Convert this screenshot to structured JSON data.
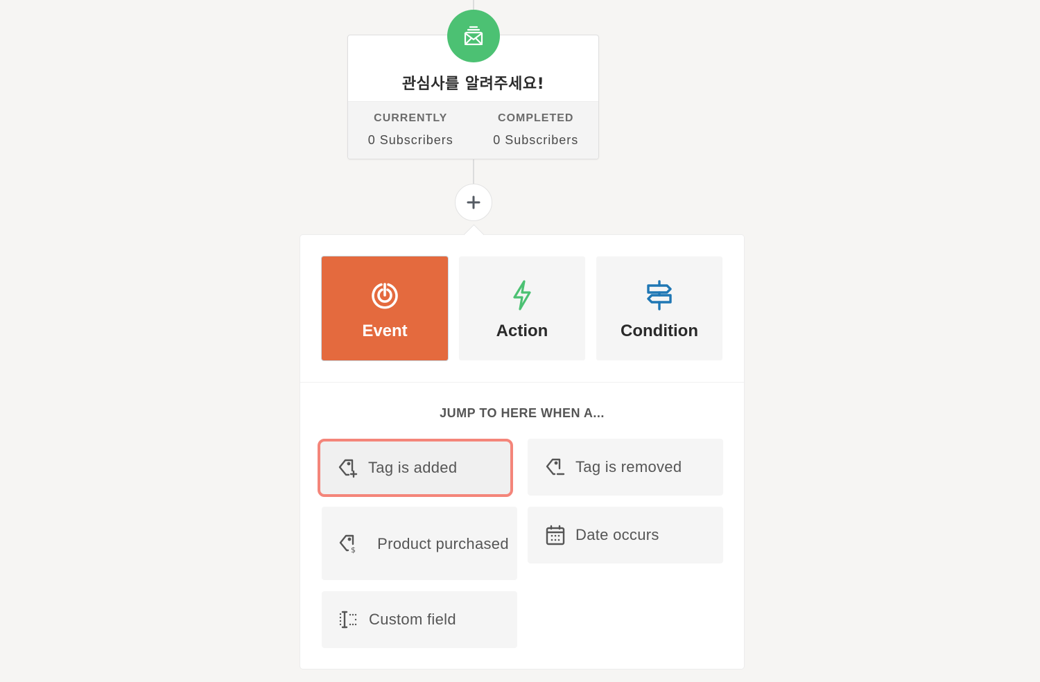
{
  "node": {
    "icon": "email-stack-icon",
    "title": "관심사를 알려주세요!",
    "stats": [
      {
        "label": "CURRENTLY",
        "value": "0 Subscribers"
      },
      {
        "label": "COMPLETED",
        "value": "0 Subscribers"
      }
    ]
  },
  "add_button": {
    "icon": "plus-icon",
    "symbol": "+"
  },
  "panel": {
    "types": [
      {
        "label": "Event",
        "icon": "target-icon",
        "active": true,
        "color": "#e46a3e"
      },
      {
        "label": "Action",
        "icon": "lightning-icon",
        "active": false,
        "color": "#4cc173"
      },
      {
        "label": "Condition",
        "icon": "signpost-icon",
        "active": false,
        "color": "#1f77b4"
      }
    ],
    "heading": "JUMP TO HERE WHEN A...",
    "options": [
      {
        "label": "Tag is added",
        "icon": "tag-add-icon",
        "selected": true
      },
      {
        "label": "Tag is removed",
        "icon": "tag-remove-icon",
        "selected": false
      },
      {
        "label": "Product purchased",
        "icon": "tag-dollar-icon",
        "selected": false
      },
      {
        "label": "Date occurs",
        "icon": "calendar-icon",
        "selected": false
      },
      {
        "label": "Custom field",
        "icon": "text-field-icon",
        "selected": false
      }
    ]
  },
  "colors": {
    "background": "#f6f5f3",
    "node_green": "#4cc173",
    "event_orange": "#e46a3e",
    "condition_blue": "#1f77b4",
    "selection_outline": "#f4857a"
  }
}
